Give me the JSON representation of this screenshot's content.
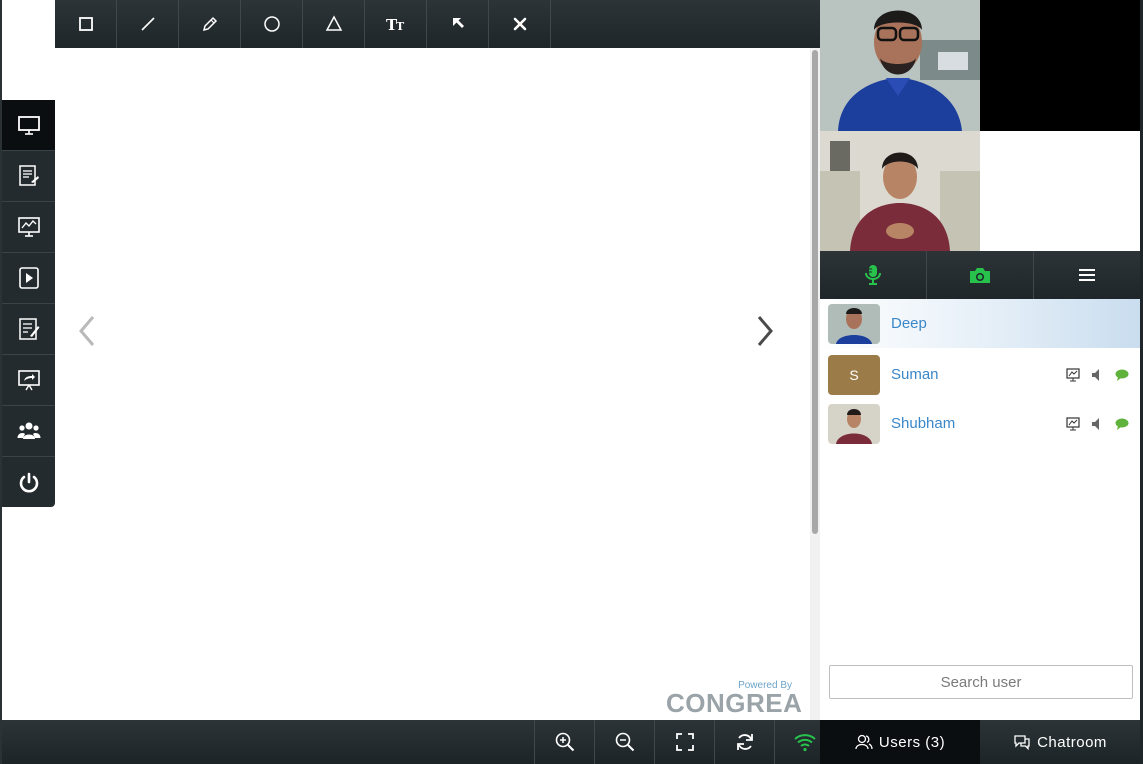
{
  "toolbar": {
    "tools": [
      "rectangle-icon",
      "line-icon",
      "pencil-icon",
      "circle-icon",
      "triangle-icon",
      "text-icon",
      "pointer-icon",
      "clear-icon"
    ],
    "text_tool_label": "TT"
  },
  "sidebar": {
    "items": [
      "whiteboard-icon",
      "document-share-icon",
      "screen-share-icon",
      "video-player-icon",
      "notes-icon",
      "presentation-share-icon",
      "breakout-users-icon",
      "power-icon"
    ],
    "active": "whiteboard-icon"
  },
  "branding": {
    "powered_by": "Powered By",
    "logo": "CONGREA"
  },
  "controls": {
    "items": [
      "microphone-icon",
      "camera-icon",
      "menu-icon"
    ],
    "accent": "#27c24c"
  },
  "users": [
    {
      "name": "Deep",
      "avatar": "photo",
      "selected": true
    },
    {
      "name": "Suman",
      "avatar_letter": "S",
      "selected": false
    },
    {
      "name": "Shubham",
      "avatar": "photo",
      "selected": false
    }
  ],
  "search": {
    "placeholder": "Search user"
  },
  "bottom": {
    "buttons": [
      "zoom-in-icon",
      "zoom-out-icon",
      "fit-screen-icon",
      "reload-icon",
      "network-signal-icon"
    ],
    "tab_users": "Users (3)",
    "tab_chatroom": "Chatroom"
  },
  "colors": {
    "bar": "#242b2f",
    "user_name": "#3a87c8",
    "signal": "#27c24c",
    "chat_bubble": "#5fb23b"
  }
}
